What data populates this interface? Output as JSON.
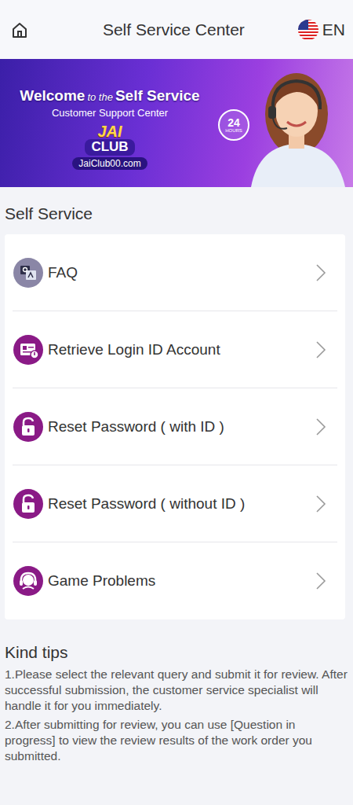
{
  "header": {
    "title": "Self Service Center",
    "language": "EN"
  },
  "banner": {
    "welcome": "Welcome",
    "to_the": "to the",
    "self_service": "Self Service",
    "subtitle": "Customer Support Center",
    "logo_top": "JAI",
    "logo_bottom": "CLUB",
    "site": "JaiClub00.com",
    "hours_number": "24",
    "hours_label": "HOURS"
  },
  "section_title": "Self Service",
  "items": [
    {
      "label": "FAQ",
      "kind": "faq"
    },
    {
      "label": "Retrieve Login ID Account",
      "kind": "id"
    },
    {
      "label": "Reset Password ( with ID )",
      "kind": "lock"
    },
    {
      "label": "Reset Password ( without ID )",
      "kind": "lock"
    },
    {
      "label": "Game Problems",
      "kind": "support"
    }
  ],
  "tips": {
    "title": "Kind tips",
    "lines": [
      "1.Please select the relevant query and submit it for review. After successful submission, the customer service specialist will handle it for you immediately.",
      "2.After submitting for review, you can use [Question in progress] to view the review results of the work order you submitted."
    ]
  }
}
